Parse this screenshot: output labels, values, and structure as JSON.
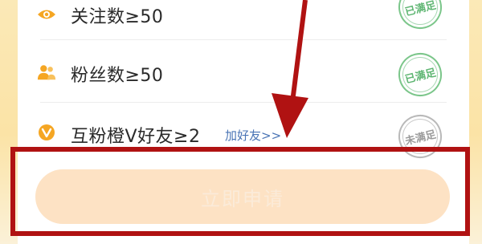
{
  "conditions": [
    {
      "label": "关注数≥50",
      "icon": "eye-icon",
      "status": "已满足",
      "met": true
    },
    {
      "label": "粉丝数≥50",
      "icon": "users-icon",
      "status": "已满足",
      "met": true
    },
    {
      "label": "互粉橙V好友≥2",
      "icon": "orange-v-icon",
      "status": "未满足",
      "met": false,
      "link": "加好友>>"
    }
  ],
  "apply_button": {
    "label": "立即申请",
    "disabled": true
  },
  "colors": {
    "accent_orange": "#f5a623",
    "stamp_met": "#5fb673",
    "stamp_unmet": "#9b9b9b",
    "annotation_red": "#b01212",
    "link_blue": "#4a74b5"
  }
}
